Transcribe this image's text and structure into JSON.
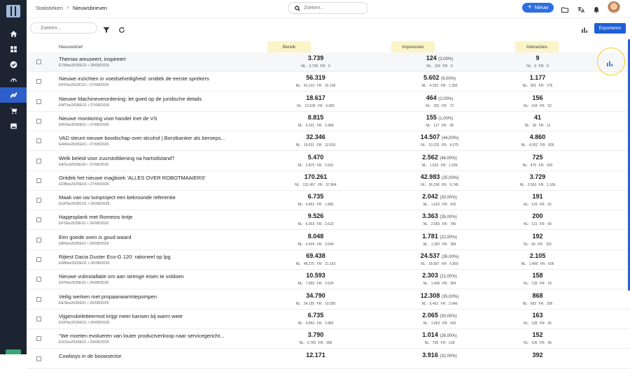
{
  "breadcrumb": {
    "parent": "Statistieken",
    "separator": ">",
    "current": "Nieuwsbrieven"
  },
  "top_search": {
    "placeholder": "Zoeken..."
  },
  "new_button": {
    "label": "Nieuw"
  },
  "toolbar": {
    "search_placeholder": "Zoeken...",
    "export_label": "Exporteren"
  },
  "table": {
    "columns": {
      "newsletter": "Nieuwsbrief",
      "reach": "Bereik",
      "impressions": "Impressies",
      "interactions": "Interacties"
    },
    "rows": [
      {
        "title": "Themax amuseert, inspireert",
        "code": "ETMbe2635E01",
        "date": "28/08/2026",
        "reach": "3.739",
        "reach_nl": "NL: 3.739",
        "reach_fr": "FR: 0",
        "impr": "124",
        "impr_pct": "(3,00%)",
        "impr_nl": "NL: 124",
        "impr_fr": "FR: 0",
        "inter": "9",
        "inter_nl": "NL: 9",
        "inter_fr": "FR: 0"
      },
      {
        "title": "Nieuwe inzichten in voedselveiligheid: ontdek de eerste sprekers",
        "code": "EFPbe2633C01",
        "date": "27/08/2026",
        "reach": "56.319",
        "reach_nl": "NL: 41.213",
        "reach_fr": "FR: 15.106",
        "impr": "5.602",
        "impr_pct": "(9,00%)",
        "impr_nl": "NL: 4.252",
        "impr_fr": "FR: 1.350",
        "inter": "1.177",
        "inter_nl": "NL: 901",
        "inter_fr": "FR: 276"
      },
      {
        "title": "Nieuwe Machineverordening: let goed op de juridische details",
        "code": "EMTbe2635E01",
        "date": "27/08/2026",
        "reach": "18.617",
        "reach_nl": "NL: 13.535",
        "reach_fr": "FR: 5.082",
        "impr": "464",
        "impr_pct": "(2,00%)",
        "impr_nl": "NL: 391",
        "impr_fr": "FR: 73",
        "inter": "156",
        "inter_nl": "NL: 104",
        "inter_fr": "FR: 52"
      },
      {
        "title": "Nieuwe monitoring voor handel met de VS",
        "code": "ERVbe2635E01",
        "date": "27/08/2026",
        "reach": "8.815",
        "reach_nl": "NL: 6.331",
        "reach_fr": "FR: 2.484",
        "impr": "155",
        "impr_pct": "(1,00%)",
        "impr_nl": "NL: 117",
        "impr_fr": "FR: 38",
        "inter": "41",
        "inter_nl": "NL: 30",
        "inter_fr": "FR: 11"
      },
      {
        "title": "VAD steunt nieuwe boodschap over alcohol | Borstkanker als beroeps...",
        "code": "EAKbe2635E01",
        "date": "27/08/2026",
        "reach": "32.346",
        "reach_nl": "NL: 19.531",
        "reach_fr": "FR: 12.815",
        "impr": "14.507",
        "impr_pct": "(44,00%)",
        "impr_nl": "NL: 10.232",
        "impr_fr": "FR: 4.275",
        "inter": "4.860",
        "inter_nl": "NL: 4.032",
        "inter_fr": "FR: 828"
      },
      {
        "title": "Welk beleid voor zuurstofdiening na hartstilstand?",
        "code": "EAScd2635E02",
        "date": "27/08/2026",
        "reach": "5.470",
        "reach_nl": "NL: 2.879",
        "reach_fr": "FR: 2.591",
        "impr": "2.562",
        "impr_pct": "(46,00%)",
        "impr_nl": "NL: 1.523",
        "impr_fr": "FR: 1.039",
        "inter": "725",
        "inter_nl": "NL: 475",
        "inter_fr": "FR: 250"
      },
      {
        "title": "Ontdek het nieuwe magboek 'ALLES OVER ROBOTMAAIERS'",
        "code": "EDBbe2635E03",
        "date": "27/08/2026",
        "reach": "170.261",
        "reach_nl": "NL: 132.457",
        "reach_fr": "FR: 37.804",
        "impr": "42.983",
        "impr_pct": "(25,00%)",
        "impr_nl": "NL: 36.238",
        "impr_fr": "FR: 6.745",
        "inter": "3.729",
        "inter_nl": "NL: 2.563",
        "inter_fr": "FR: 1.166"
      },
      {
        "title": "Maak van uw tuinproject een bekroonde referentie",
        "code": "EGPbe2635C01",
        "date": "26/08/2026",
        "reach": "6.735",
        "reach_nl": "NL: 4.853",
        "reach_fr": "FR: 1.882",
        "impr": "2.042",
        "impr_pct": "(30,00%)",
        "impr_nl": "NL: 1.622",
        "impr_fr": "FR: 420",
        "inter": "191",
        "inter_nl": "NL: 129",
        "inter_fr": "FR: 62"
      },
      {
        "title": "Hapjesplank met Romeins tintje",
        "code": "EFSbe2635E01",
        "date": "26/08/2026",
        "reach": "9.526",
        "reach_nl": "NL: 6.903",
        "reach_fr": "FR: 2.623",
        "impr": "3.363",
        "impr_pct": "(35,00%)",
        "impr_nl": "NL: 2.583",
        "impr_fr": "FR: 780",
        "inter": "200",
        "inter_nl": "NL: 131",
        "inter_fr": "FR: 69"
      },
      {
        "title": "Een goede oven is goud waard",
        "code": "EBKbe2635E01",
        "date": "26/08/2026",
        "reach": "8.048",
        "reach_nl": "NL: 4.404",
        "reach_fr": "FR: 3.644",
        "impr": "1.781",
        "impr_pct": "(22,00%)",
        "impr_nl": "NL: 1.392",
        "impr_fr": "FR: 389",
        "inter": "192",
        "inter_nl": "NL: 90",
        "inter_fr": "FR: 102"
      },
      {
        "title": "Rijtest Dacia Duster Eco-G 120: rationeel op lpg",
        "code": "EMBbe2635E01",
        "date": "26/08/2026",
        "reach": "69.438",
        "reach_nl": "NL: 48.275",
        "reach_fr": "FR: 21.163",
        "impr": "24.537",
        "impr_pct": "(35,00%)",
        "impr_nl": "NL: 18.687",
        "impr_fr": "FR: 5.850",
        "inter": "2.105",
        "inter_nl": "NL: 1.499",
        "inter_fr": "FR: 606"
      },
      {
        "title": "Nieuwe vulinstallatie om aan strenge eisen te voldoen",
        "code": "EFPbe2635E01",
        "date": "26/08/2026",
        "reach": "10.593",
        "reach_nl": "NL: 7.969",
        "reach_fr": "FR: 2.624",
        "impr": "2.303",
        "impr_pct": "(21,00%)",
        "impr_nl": "NL: 1.949",
        "impr_fr": "FR: 354",
        "inter": "158",
        "inter_nl": "NL: 139",
        "inter_fr": "FR: 19"
      },
      {
        "title": "Veilig werken met propaanwarmtepompen",
        "code": "EESbe2635E01",
        "date": "26/08/2026",
        "reach": "34.790",
        "reach_nl": "NL: 24.195",
        "reach_fr": "FR: 10.595",
        "impr": "12.308",
        "impr_pct": "(35,00%)",
        "impr_nl": "NL: 9.462",
        "impr_fr": "FR: 2.846",
        "inter": "868",
        "inter_nl": "NL: 662",
        "inter_fr": "FR: 206"
      },
      {
        "title": "Vijgenskeletteermot krijgt meer kansen bij warm weer",
        "code": "EGPbe2635E01",
        "date": "26/08/2026",
        "reach": "6.735",
        "reach_nl": "NL: 4.853",
        "reach_fr": "FR: 1.882",
        "impr": "2.065",
        "impr_pct": "(30,00%)",
        "impr_nl": "NL: 1.663",
        "impr_fr": "FR: 402",
        "inter": "163",
        "inter_nl": "NL: 128",
        "inter_fr": "FR: 35"
      },
      {
        "title": "\"We moeten evolueren van louter productverkoop naar servicegericht...",
        "code": "ESCbe2635E01",
        "date": "26/08/2026",
        "reach": "3.790",
        "reach_nl": "NL: 2.795",
        "reach_fr": "FR: 995",
        "impr": "1.014",
        "impr_pct": "(26,00%)",
        "impr_nl": "NL: 796",
        "impr_fr": "FR: 218",
        "inter": "152",
        "inter_nl": "NL: 106",
        "inter_fr": "FR: 46"
      },
      {
        "title": "Cowboys in de bouwsector",
        "code": "",
        "date": "",
        "reach": "12.171",
        "reach_nl": "",
        "reach_fr": "",
        "impr": "3.916",
        "impr_pct": "(32,00%)",
        "impr_nl": "",
        "impr_fr": "",
        "inter": "392",
        "inter_nl": "",
        "inter_fr": ""
      }
    ]
  }
}
